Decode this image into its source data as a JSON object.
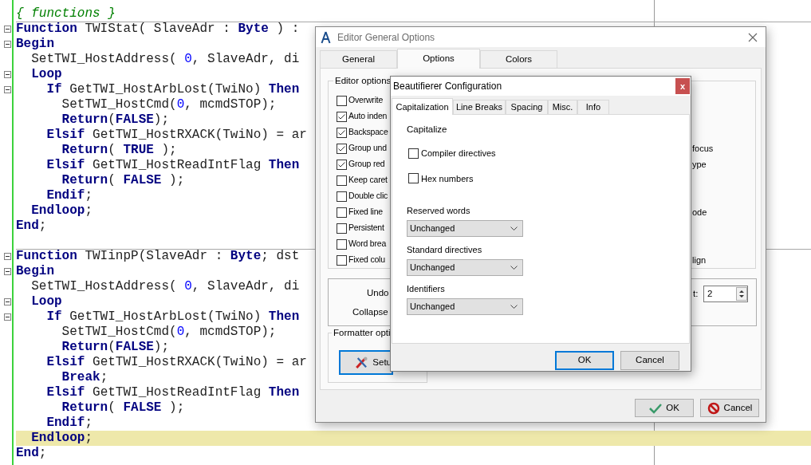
{
  "editor": {
    "lines": [
      {
        "tokens": [
          {
            "text": "{ functions }",
            "kind": "comment"
          }
        ]
      },
      {
        "separator": true,
        "fold": true,
        "tokens": [
          {
            "text": "Function",
            "kind": "keyword"
          },
          {
            "text": " TWIStat( SlaveAdr : ",
            "kind": "plain"
          },
          {
            "text": "Byte",
            "kind": "keyword"
          },
          {
            "text": " ) :",
            "kind": "plain"
          }
        ]
      },
      {
        "fold": true,
        "tokens": [
          {
            "text": "Begin",
            "kind": "keyword"
          }
        ]
      },
      {
        "tokens": [
          {
            "text": "  SetTWI_HostAddress( ",
            "kind": "plain"
          },
          {
            "text": "0",
            "kind": "number"
          },
          {
            "text": ", SlaveAdr, di",
            "kind": "plain"
          }
        ]
      },
      {
        "fold": true,
        "tokens": [
          {
            "text": "  Loop",
            "kind": "keyword"
          }
        ]
      },
      {
        "fold": true,
        "tokens": [
          {
            "text": "    If",
            "kind": "keyword"
          },
          {
            "text": " GetTWI_HostArbLost(TwiNo) ",
            "kind": "plain"
          },
          {
            "text": "Then",
            "kind": "keyword"
          }
        ]
      },
      {
        "tokens": [
          {
            "text": "      SetTWI_HostCmd(",
            "kind": "plain"
          },
          {
            "text": "0",
            "kind": "number"
          },
          {
            "text": ", mcmdSTOP);",
            "kind": "plain"
          }
        ]
      },
      {
        "tokens": [
          {
            "text": "      Return",
            "kind": "keyword"
          },
          {
            "text": "(",
            "kind": "plain"
          },
          {
            "text": "FALSE",
            "kind": "keyword"
          },
          {
            "text": ");",
            "kind": "plain"
          }
        ]
      },
      {
        "tokens": [
          {
            "text": "    Elsif",
            "kind": "keyword"
          },
          {
            "text": " GetTWI_HostRXACK(TwiNo) = ar",
            "kind": "plain"
          }
        ]
      },
      {
        "tokens": [
          {
            "text": "      Return",
            "kind": "keyword"
          },
          {
            "text": "( ",
            "kind": "plain"
          },
          {
            "text": "TRUE",
            "kind": "keyword"
          },
          {
            "text": " );",
            "kind": "plain"
          }
        ]
      },
      {
        "tokens": [
          {
            "text": "    Elsif",
            "kind": "keyword"
          },
          {
            "text": " GetTWI_HostReadIntFlag ",
            "kind": "plain"
          },
          {
            "text": "Then",
            "kind": "keyword"
          }
        ]
      },
      {
        "tokens": [
          {
            "text": "      Return",
            "kind": "keyword"
          },
          {
            "text": "( ",
            "kind": "plain"
          },
          {
            "text": "FALSE",
            "kind": "keyword"
          },
          {
            "text": " );",
            "kind": "plain"
          }
        ]
      },
      {
        "tokens": [
          {
            "text": "    Endif",
            "kind": "keyword"
          },
          {
            "text": ";",
            "kind": "plain"
          }
        ]
      },
      {
        "tokens": [
          {
            "text": "  Endloop",
            "kind": "keyword"
          },
          {
            "text": ";",
            "kind": "plain"
          }
        ]
      },
      {
        "tokens": [
          {
            "text": "End",
            "kind": "keyword"
          },
          {
            "text": ";",
            "kind": "plain"
          }
        ]
      },
      {
        "kind": "blank"
      },
      {
        "separator": true,
        "fold": true,
        "tokens": [
          {
            "text": "Function",
            "kind": "keyword"
          },
          {
            "text": " TWIinpP(SlaveAdr : ",
            "kind": "plain"
          },
          {
            "text": "Byte",
            "kind": "keyword"
          },
          {
            "text": "; dst",
            "kind": "plain"
          }
        ]
      },
      {
        "fold": true,
        "tokens": [
          {
            "text": "Begin",
            "kind": "keyword"
          }
        ]
      },
      {
        "tokens": [
          {
            "text": "  SetTWI_HostAddress( ",
            "kind": "plain"
          },
          {
            "text": "0",
            "kind": "number"
          },
          {
            "text": ", SlaveAdr, di",
            "kind": "plain"
          }
        ]
      },
      {
        "fold": true,
        "tokens": [
          {
            "text": "  Loop",
            "kind": "keyword"
          }
        ]
      },
      {
        "fold": true,
        "tokens": [
          {
            "text": "    If",
            "kind": "keyword"
          },
          {
            "text": " GetTWI_HostArbLost(TwiNo) ",
            "kind": "plain"
          },
          {
            "text": "Then",
            "kind": "keyword"
          }
        ]
      },
      {
        "tokens": [
          {
            "text": "      SetTWI_HostCmd(",
            "kind": "plain"
          },
          {
            "text": "0",
            "kind": "number"
          },
          {
            "text": ", mcmdSTOP);",
            "kind": "plain"
          }
        ]
      },
      {
        "tokens": [
          {
            "text": "      Return",
            "kind": "keyword"
          },
          {
            "text": "(",
            "kind": "plain"
          },
          {
            "text": "FALSE",
            "kind": "keyword"
          },
          {
            "text": ");",
            "kind": "plain"
          }
        ]
      },
      {
        "tokens": [
          {
            "text": "    Elsif",
            "kind": "keyword"
          },
          {
            "text": " GetTWI_HostRXACK(TwiNo) = ar",
            "kind": "plain"
          }
        ]
      },
      {
        "tokens": [
          {
            "text": "      Break",
            "kind": "keyword"
          },
          {
            "text": ";",
            "kind": "plain"
          }
        ]
      },
      {
        "tokens": [
          {
            "text": "    Elsif",
            "kind": "keyword"
          },
          {
            "text": " GetTWI_HostReadIntFlag ",
            "kind": "plain"
          },
          {
            "text": "Then",
            "kind": "keyword"
          }
        ]
      },
      {
        "tokens": [
          {
            "text": "      Return",
            "kind": "keyword"
          },
          {
            "text": "( ",
            "kind": "plain"
          },
          {
            "text": "FALSE",
            "kind": "keyword"
          },
          {
            "text": " );",
            "kind": "plain"
          }
        ]
      },
      {
        "tokens": [
          {
            "text": "    Endif",
            "kind": "keyword"
          },
          {
            "text": ";",
            "kind": "plain"
          }
        ]
      },
      {
        "highlighted": true,
        "tokens": [
          {
            "text": "  Endloop",
            "kind": "keyword"
          },
          {
            "text": ";",
            "kind": "plain"
          }
        ]
      },
      {
        "tokens": [
          {
            "text": "End",
            "kind": "keyword"
          },
          {
            "text": ";",
            "kind": "plain"
          }
        ]
      }
    ]
  },
  "options_dialog": {
    "title": "Editor General Options",
    "tabs": [
      {
        "label": "General",
        "selected": false
      },
      {
        "label": "Options",
        "selected": true
      },
      {
        "label": "Colors",
        "selected": false
      }
    ],
    "editor_options": {
      "title": "Editor options",
      "rows": [
        {
          "label": "Overwrite",
          "checked": false
        },
        {
          "label": "Auto inden",
          "checked": true
        },
        {
          "label": "Backspace",
          "checked": true
        },
        {
          "label": "Group und",
          "checked": true,
          "right_text": "focus"
        },
        {
          "label": "Group red",
          "checked": true,
          "right_text": "ype"
        },
        {
          "label": "Keep caret",
          "checked": false
        },
        {
          "label": "Double clic",
          "checked": false
        },
        {
          "label": "Fixed line",
          "checked": false,
          "right_text": "ode"
        },
        {
          "label": "Persistent",
          "checked": false
        },
        {
          "label": "Word brea",
          "checked": false
        },
        {
          "label": "Fixed colu",
          "checked": false,
          "right_text": "lign"
        }
      ]
    },
    "undo_label": "Undo",
    "collapse_label": "Collapse",
    "spin_label": "t:",
    "spin_value": "2",
    "formatter": {
      "title": "Formatter opti",
      "button": "Setu"
    },
    "buttons": [
      {
        "label": "OK",
        "kind": "ok"
      },
      {
        "label": "Cancel",
        "kind": "cancel"
      }
    ]
  },
  "beautifier_dialog": {
    "title": "Beautifierer Configuration",
    "close": "x",
    "tabs": [
      {
        "label": "Capitalization",
        "selected": true
      },
      {
        "label": "Line Breaks",
        "selected": false
      },
      {
        "label": "Spacing",
        "selected": false
      },
      {
        "label": "Misc.",
        "selected": false
      },
      {
        "label": "Info",
        "selected": false
      }
    ],
    "heading": "Capitalize",
    "checkboxes": [
      {
        "label": "Compiler directives",
        "checked": false
      },
      {
        "label": "Hex numbers",
        "checked": false
      }
    ],
    "selects": [
      {
        "label": "Reserved words",
        "value": "Unchanged"
      },
      {
        "label": "Standard directives",
        "value": "Unchanged"
      },
      {
        "label": "Identifiers",
        "value": "Unchanged"
      }
    ],
    "buttons": [
      {
        "label": "OK",
        "default": true
      },
      {
        "label": "Cancel",
        "default": false
      }
    ]
  }
}
